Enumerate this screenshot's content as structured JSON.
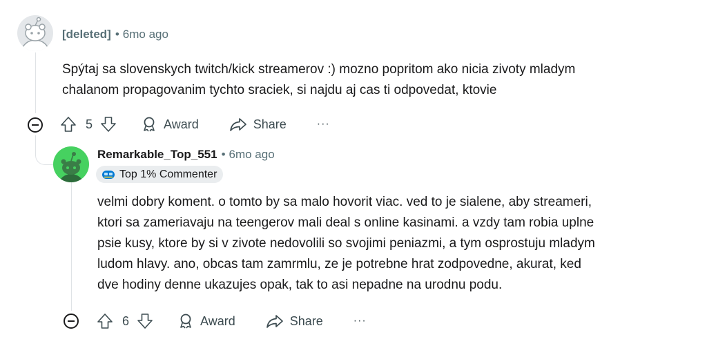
{
  "comment1": {
    "author": "[deleted]",
    "separator": "•",
    "time": "6mo ago",
    "body": [
      "Spýtaj sa slovenskych twitch/kick streamerov :) mozno popritom ako nicia zivoty mladym",
      "chalanom propagovanim tychto sraciek, si najdu aj cas ti odpovedat, ktovie"
    ],
    "votes": "5",
    "award_label": "Award",
    "share_label": "Share",
    "more_label": "···"
  },
  "comment2": {
    "author": "Remarkable_Top_551",
    "separator": "•",
    "time": "6mo ago",
    "flair": "Top 1% Commenter",
    "body": [
      "velmi dobry koment. o tomto by sa malo hovorit viac. ved to je sialene, aby streameri,",
      "ktori sa zameriavaju na teengerov mali deal s online kasinami. a vzdy tam robia uplne",
      "psie kusy, ktore by si v zivote nedovolili so svojimi peniazmi, a tym osprostuju mladym",
      "ludom hlavy. ano, obcas tam zamrmlu, ze je potrebne hrat zodpovedne, akurat, ked",
      "dve hodiny denne ukazujes opak, tak to asi nepadne na urodnu podu."
    ],
    "votes": "6",
    "award_label": "Award",
    "share_label": "Share",
    "more_label": "···"
  },
  "colors": {
    "meta": "#576f76",
    "text": "#1a1a1b",
    "thread_line": "#dfe3e6",
    "avatar_green": "#46d160",
    "flair_bg": "#eaedef"
  }
}
